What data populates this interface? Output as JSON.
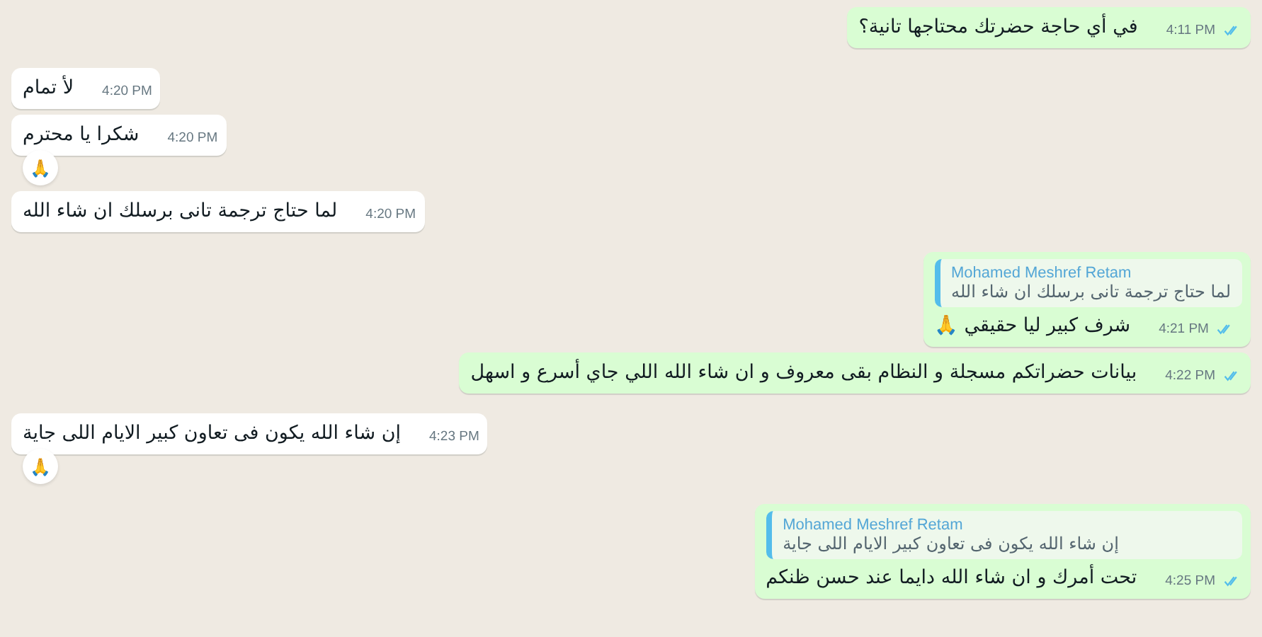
{
  "messages": [
    {
      "kind": "outgoing",
      "text": "في أي حاجة حضرتك محتاجها تانية؟",
      "time": "4:11 PM",
      "read": true
    },
    {
      "kind": "incoming",
      "text": "لأ تمام",
      "time": "4:20 PM"
    },
    {
      "kind": "incoming",
      "text": "شكرا يا محترم",
      "time": "4:20 PM",
      "reaction": "🙏"
    },
    {
      "kind": "incoming",
      "text": "لما حتاج ترجمة تانى برسلك ان شاء الله",
      "time": "4:20 PM"
    },
    {
      "kind": "outgoing",
      "quote": {
        "author": "Mohamed Meshref Retam",
        "text": "لما حتاج ترجمة تانى برسلك ان شاء الله"
      },
      "text": "شرف كبير ليا حقيقي 🙏",
      "time": "4:21 PM",
      "read": true
    },
    {
      "kind": "outgoing",
      "text": "بيانات حضراتكم مسجلة و النظام بقى معروف و ان شاء الله اللي جاي أسرع و اسهل",
      "time": "4:22 PM",
      "read": true
    },
    {
      "kind": "incoming",
      "text": "إن شاء الله يكون فى تعاون كبير الايام اللى جاية",
      "time": "4:23 PM",
      "reaction": "🙏"
    },
    {
      "kind": "outgoing",
      "quote": {
        "author": "Mohamed Meshref Retam",
        "text": "إن شاء الله يكون فى تعاون كبير الايام اللى جاية"
      },
      "text": "تحت أمرك و ان شاء الله دايما عند حسن ظنكم",
      "time": "4:25 PM",
      "read": true
    }
  ]
}
